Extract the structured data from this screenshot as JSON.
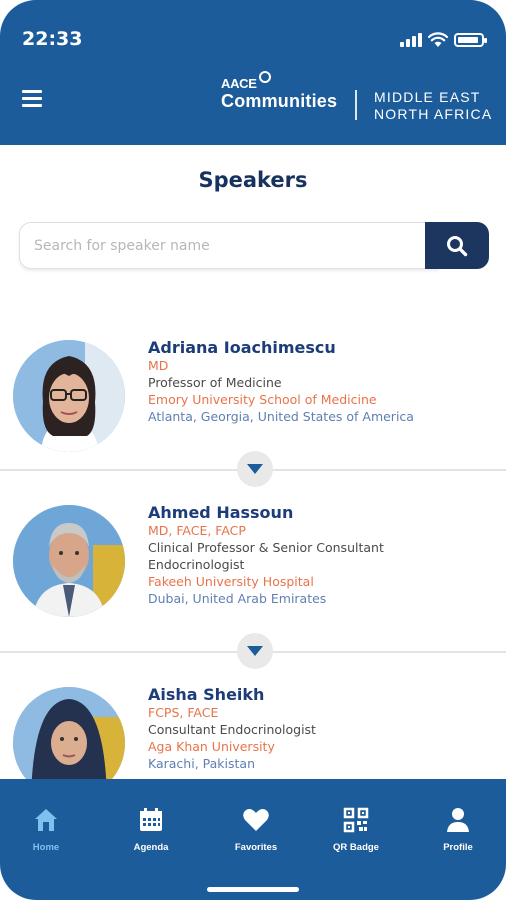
{
  "status_bar": {
    "time": "22:33"
  },
  "header": {
    "brand_top": "AACE",
    "brand_main": "Communities",
    "region_line1": "MIDDLE EAST",
    "region_line2": "NORTH AFRICA",
    "menu_icon": "hamburger-icon"
  },
  "page": {
    "title": "Speakers"
  },
  "search": {
    "placeholder": "Search for speaker name",
    "value": "",
    "button_icon": "search-icon"
  },
  "speakers": [
    {
      "name": "Adriana Ioachimescu",
      "credentials": "MD",
      "title": "Professor of Medicine",
      "title2": "",
      "institution": "Emory University School of Medicine",
      "location": "Atlanta, Georgia, United States of America"
    },
    {
      "name": "Ahmed Hassoun",
      "credentials": "MD, FACE, FACP",
      "title": "Clinical Professor & Senior Consultant",
      "title2": "Endocrinologist",
      "institution": "Fakeeh University Hospital",
      "location": "Dubai, United Arab Emirates"
    },
    {
      "name": "Aisha Sheikh",
      "credentials": "FCPS, FACE",
      "title": "Consultant Endocrinologist",
      "title2": "",
      "institution": "Aga Khan University",
      "location": "Karachi, Pakistan"
    }
  ],
  "bottom_nav": {
    "items": [
      {
        "label": "Home",
        "icon": "home-icon",
        "active": true
      },
      {
        "label": "Agenda",
        "icon": "calendar-icon",
        "active": false
      },
      {
        "label": "Favorites",
        "icon": "heart-icon",
        "active": false
      },
      {
        "label": "QR Badge",
        "icon": "qr-code-icon",
        "active": false
      },
      {
        "label": "Profile",
        "icon": "person-icon",
        "active": false
      }
    ]
  },
  "colors": {
    "primary": "#1d5c9a",
    "navy": "#1d3660",
    "accent": "#e8734a",
    "active_nav": "#7ec0ee"
  }
}
